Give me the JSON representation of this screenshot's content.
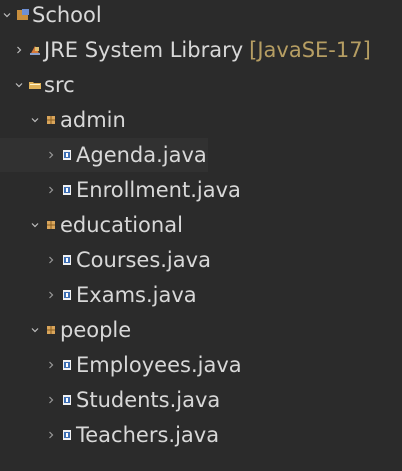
{
  "tree": {
    "project": {
      "label": "School"
    },
    "jre": {
      "label": "JRE System Library",
      "decoration": "[JavaSE-17]"
    },
    "src": {
      "label": "src"
    },
    "admin": {
      "label": "admin"
    },
    "agenda": {
      "label": "Agenda.java"
    },
    "enrollment": {
      "label": "Enrollment.java"
    },
    "educational": {
      "label": "educational"
    },
    "courses": {
      "label": "Courses.java"
    },
    "exams": {
      "label": "Exams.java"
    },
    "people": {
      "label": "people"
    },
    "employees": {
      "label": "Employees.java"
    },
    "students": {
      "label": "Students.java"
    },
    "teachers": {
      "label": "Teachers.java"
    }
  },
  "colors": {
    "background": "#2b2b2b",
    "text": "#d8d8d8",
    "decoration": "#b69e63",
    "package_icon": "#d9a55b"
  },
  "icons": {
    "expanded": "chevron-down-icon",
    "collapsed": "chevron-right-icon",
    "project": "java-project-icon",
    "library": "library-icon",
    "source_folder": "source-folder-icon",
    "package": "package-icon",
    "java_file": "java-file-icon"
  }
}
